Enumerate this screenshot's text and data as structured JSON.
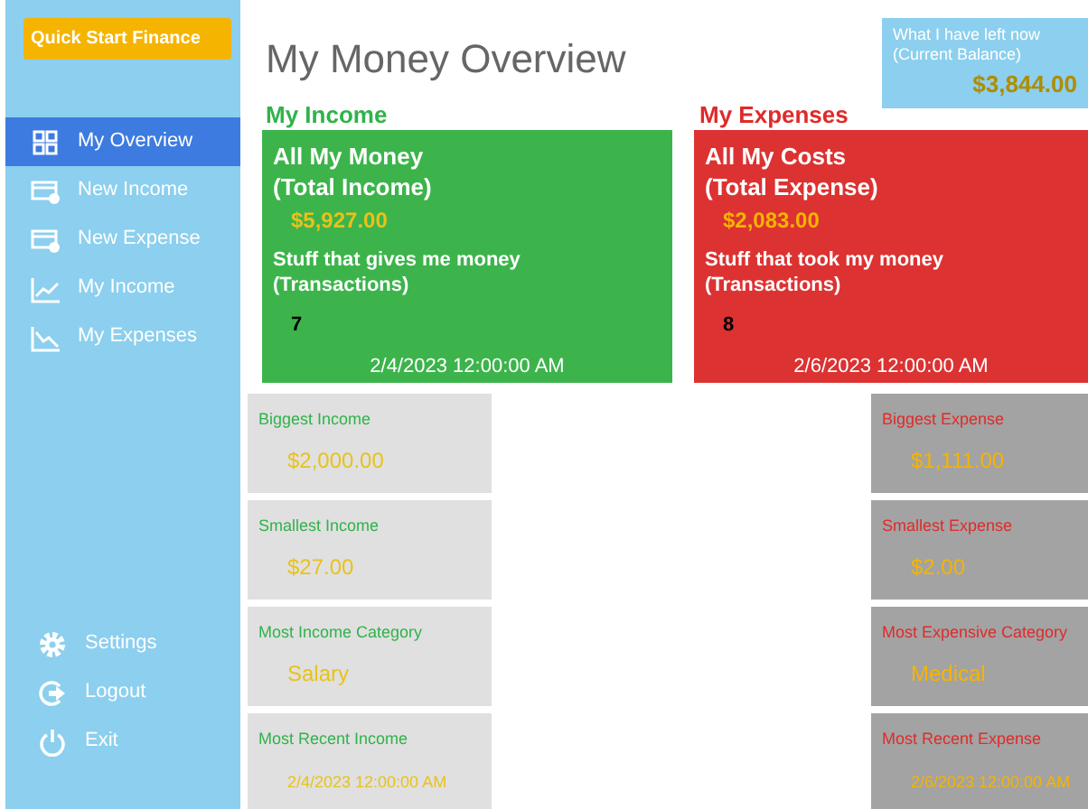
{
  "sidebar": {
    "brand": "Quick Start Finance",
    "nav": [
      {
        "label": "My Overview",
        "selected": true
      },
      {
        "label": "New Income",
        "selected": false
      },
      {
        "label": "New Expense",
        "selected": false
      },
      {
        "label": "My Income",
        "selected": false
      },
      {
        "label": "My Expenses",
        "selected": false
      }
    ],
    "bottom": [
      {
        "label": "Settings"
      },
      {
        "label": "Logout"
      },
      {
        "label": "Exit"
      }
    ]
  },
  "title": "My Money Overview",
  "balance": {
    "label": "What I have left now (Current Balance)",
    "amount": "$3,844.00"
  },
  "sections": [
    {
      "kind": "income",
      "heading": "My Income",
      "total_label": [
        "All My Money",
        "(Total Income)"
      ],
      "total": "$5,927.00",
      "transactions_label": [
        "Stuff that gives me money",
        "(Transactions)"
      ],
      "count": "7",
      "date": "2/4/2023 12:00:00 AM",
      "stats": [
        {
          "label": "Biggest Income",
          "value": "$2,000.00"
        },
        {
          "label": "Smallest Income",
          "value": "$27.00"
        },
        {
          "label": "Most Income Category",
          "value": "Salary"
        },
        {
          "label": "Most Recent Income",
          "value": "2/4/2023 12:00:00 AM"
        }
      ]
    },
    {
      "kind": "expense",
      "heading": "My Expenses",
      "total_label": [
        "All My Costs",
        "(Total Expense)"
      ],
      "total": "$2,083.00",
      "transactions_label": [
        "Stuff that took my money",
        "(Transactions)"
      ],
      "count": "8",
      "date": "2/6/2023 12:00:00 AM",
      "stats": [
        {
          "label": "Biggest Expense",
          "value": "$1,111.00"
        },
        {
          "label": "Smallest Expense",
          "value": "$2.00"
        },
        {
          "label": "Most Expensive Category",
          "value": "Medical"
        },
        {
          "label": "Most Recent Expense",
          "value": "2/6/2023 12:00:00 AM"
        }
      ]
    }
  ]
}
